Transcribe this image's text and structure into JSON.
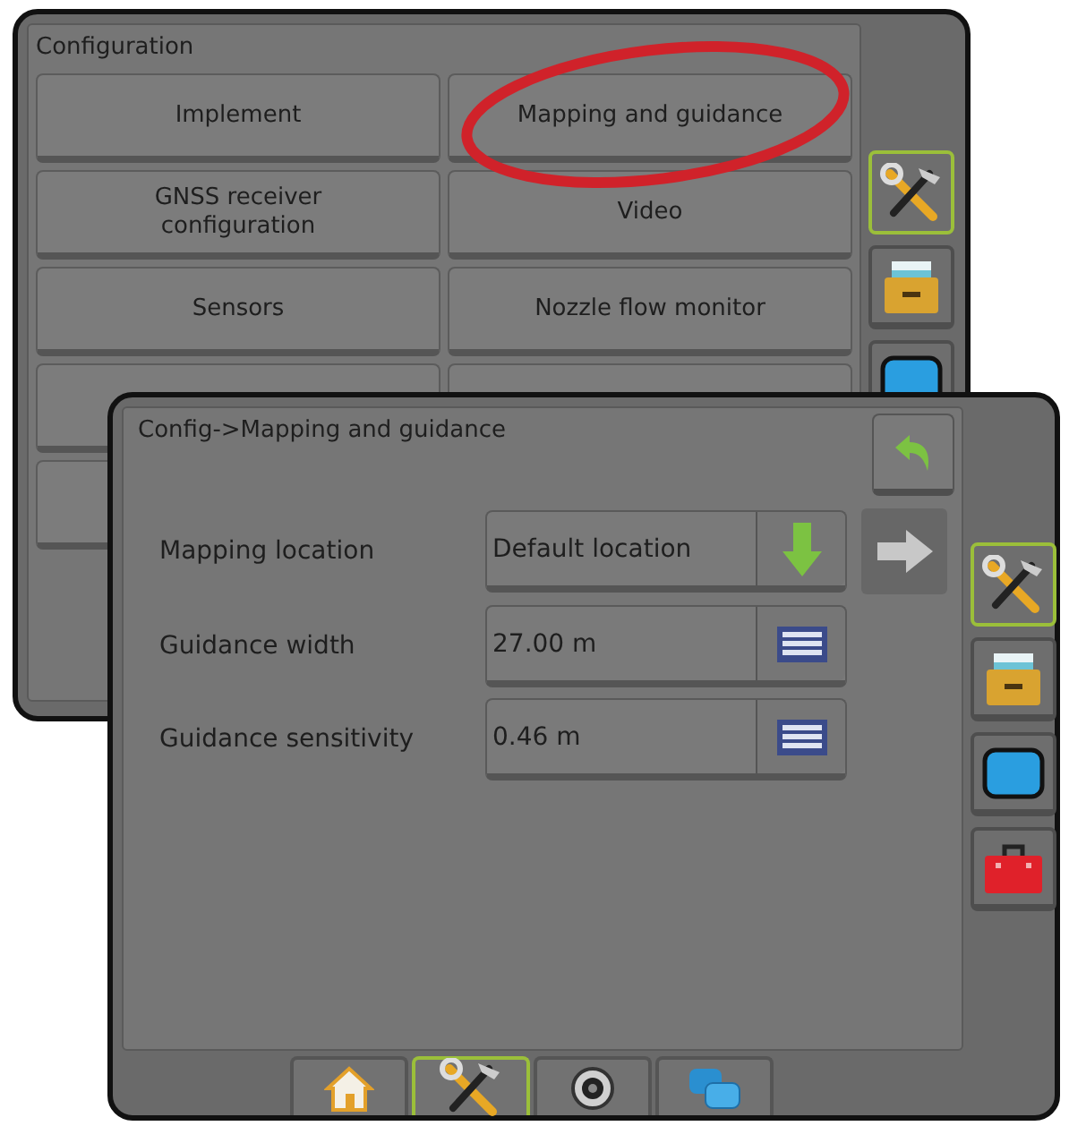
{
  "config_window": {
    "title": "Configuration",
    "buttons": [
      {
        "label": "Implement"
      },
      {
        "label": "Mapping and guidance"
      },
      {
        "label": "GNSS receiver configuration"
      },
      {
        "label": "Video"
      },
      {
        "label": "Sensors"
      },
      {
        "label": "Nozzle flow monitor"
      }
    ],
    "side_tabs": [
      {
        "kind": "tools",
        "selected": true
      },
      {
        "kind": "drawer",
        "selected": false
      },
      {
        "kind": "screen",
        "selected": false
      }
    ]
  },
  "annotation": {
    "kind": "ellipse"
  },
  "detail_window": {
    "title": "Config->Mapping and guidance",
    "settings": [
      {
        "label": "Mapping location",
        "value": "Default location",
        "kind": "select"
      },
      {
        "label": "Guidance width",
        "value": "27.00 m",
        "kind": "keypad"
      },
      {
        "label": "Guidance sensitivity",
        "value": "0.46 m",
        "kind": "keypad"
      }
    ],
    "side_tabs": [
      {
        "kind": "tools",
        "selected": true
      },
      {
        "kind": "drawer",
        "selected": false
      },
      {
        "kind": "screen",
        "selected": false
      },
      {
        "kind": "toolbox",
        "selected": false
      }
    ],
    "bottom_tabs": [
      {
        "kind": "home",
        "selected": false
      },
      {
        "kind": "tools",
        "selected": true
      },
      {
        "kind": "camera",
        "selected": false
      },
      {
        "kind": "screens",
        "selected": false
      }
    ]
  }
}
